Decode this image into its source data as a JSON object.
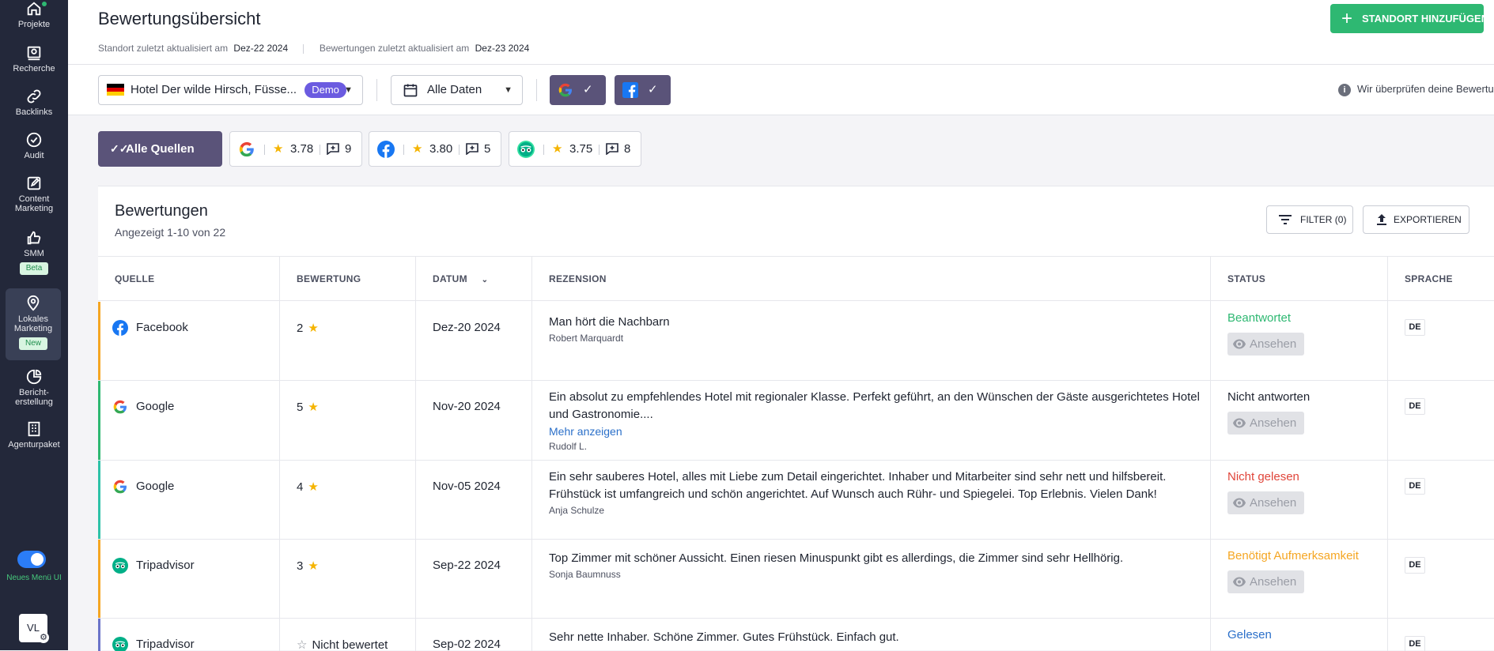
{
  "sidebar": {
    "items": [
      {
        "label": "Projekte",
        "icon": "home-icon"
      },
      {
        "label": "Recherche",
        "icon": "research-icon"
      },
      {
        "label": "Backlinks",
        "icon": "link-icon"
      },
      {
        "label": "Audit",
        "icon": "check-circle-icon"
      },
      {
        "label": "Content Marketing",
        "icon": "edit-icon"
      },
      {
        "label": "SMM",
        "icon": "thumbs-up-icon",
        "badge": "Beta"
      },
      {
        "label": "Lokales Marketing",
        "icon": "location-pin-icon",
        "badge": "New",
        "active": true
      },
      {
        "label": "Bericht-erstellung",
        "icon": "pie-chart-icon"
      },
      {
        "label": "Agenturpaket",
        "icon": "building-icon"
      }
    ],
    "toggle_label": "Neues Menü UI",
    "avatar_initials": "VL"
  },
  "header": {
    "title": "Bewertungsübersicht",
    "location_updated_label": "Standort zuletzt aktualisiert am",
    "location_updated_date": "Dez-22 2024",
    "reviews_updated_label": "Bewertungen zuletzt aktualisiert am",
    "reviews_updated_date": "Dez-23 2024",
    "add_location_button": "STANDORT HINZUFÜGEN"
  },
  "toolbar": {
    "location_select": "Hotel Der wilde Hirsch, Füsse...",
    "demo_badge": "Demo",
    "date_select": "Alle Daten",
    "info_text": "Wir überprüfen deine Bewertungen täglich"
  },
  "sources": {
    "all_label": "Alle Quellen",
    "google": {
      "rating": "3.78",
      "count": "9"
    },
    "facebook": {
      "rating": "3.80",
      "count": "5"
    },
    "tripadvisor": {
      "rating": "3.75",
      "count": "8"
    }
  },
  "reviews": {
    "title": "Bewertungen",
    "subtitle": "Angezeigt 1-10 von 22",
    "filter_button": "FILTER (0)",
    "export_button": "EXPORTIEREN",
    "columns": [
      "QUELLE",
      "BEWERTUNG",
      "DATUM",
      "REZENSION",
      "STATUS",
      "SPRACHE"
    ],
    "view_label": "Ansehen",
    "rows": [
      {
        "source": "Facebook",
        "rating": "2",
        "date": "Dez-20 2024",
        "title": "Man hört die Nachbarn",
        "author": "Robert Marquardt",
        "status": "Beantwortet",
        "status_color": "#2eb872",
        "lang": "DE",
        "accent": "#f5a623"
      },
      {
        "source": "Google",
        "rating": "5",
        "date": "Nov-20 2024",
        "title": "Ein absolut zu empfehlendes Hotel mit regionaler Klasse. Perfekt geführt, an den Wünschen der Gäste ausgerichtetes Hotel und Gastronomie....",
        "more": "Mehr anzeigen",
        "author": "Rudolf L.",
        "status": "Nicht antworten",
        "status_color": "#1f2430",
        "lang": "DE",
        "accent": "#2eb872"
      },
      {
        "source": "Google",
        "rating": "4",
        "date": "Nov-05 2024",
        "title": "Ein sehr sauberes Hotel, alles mit Liebe zum Detail eingerichtet. Inhaber und Mitarbeiter sind sehr nett und hilfsbereit. Frühstück ist umfangreich und schön angerichtet. Auf Wunsch auch Rühr- und Spiegelei. Top Erlebnis. Vielen Dank!",
        "author": "Anja Schulze",
        "status": "Nicht gelesen",
        "status_color": "#e0453a",
        "lang": "DE",
        "accent": "#2ec2a8"
      },
      {
        "source": "Tripadvisor",
        "rating": "3",
        "date": "Sep-22 2024",
        "title": "Top Zimmer mit schöner Aussicht. Einen riesen Minuspunkt gibt es allerdings, die Zimmer sind sehr Hellhörig.",
        "author": "Sonja Baumnuss",
        "status": "Benötigt Aufmerksamkeit",
        "status_color": "#f5a623",
        "lang": "DE",
        "accent": "#f5a623"
      },
      {
        "source": "Tripadvisor",
        "rating": "Nicht bewertet",
        "date": "Sep-02 2024",
        "title": "Sehr nette Inhaber. Schöne Zimmer. Gutes Frühstück. Einfach gut.",
        "author": "",
        "status": "Gelesen",
        "status_color": "#2a6fc9",
        "lang": "DE",
        "accent": "#6b73c9"
      }
    ]
  }
}
